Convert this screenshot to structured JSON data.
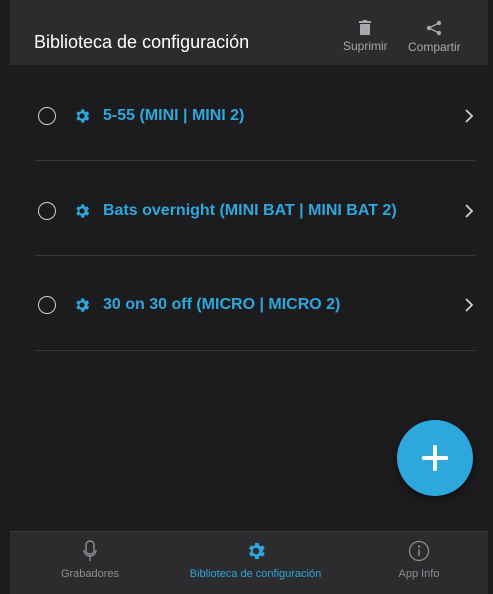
{
  "header": {
    "title": "Biblioteca de configuración",
    "delete_label": "Suprimir",
    "share_label": "Compartir"
  },
  "configs": [
    {
      "name": "5-55 (MINI | MINI 2)"
    },
    {
      "name": "Bats overnight (MINI BAT | MINI BAT 2)"
    },
    {
      "name": "30 on 30 off (MICRO | MICRO 2)"
    }
  ],
  "tabbar": {
    "recorders_label": "Grabadores",
    "library_label": "Biblioteca de configuración",
    "info_label": "App Info",
    "active": "library"
  },
  "colors": {
    "accent": "#2ea7dc",
    "background": "#1c1c1e",
    "bar": "#2c2c2e",
    "muted": "#8e8e93"
  }
}
